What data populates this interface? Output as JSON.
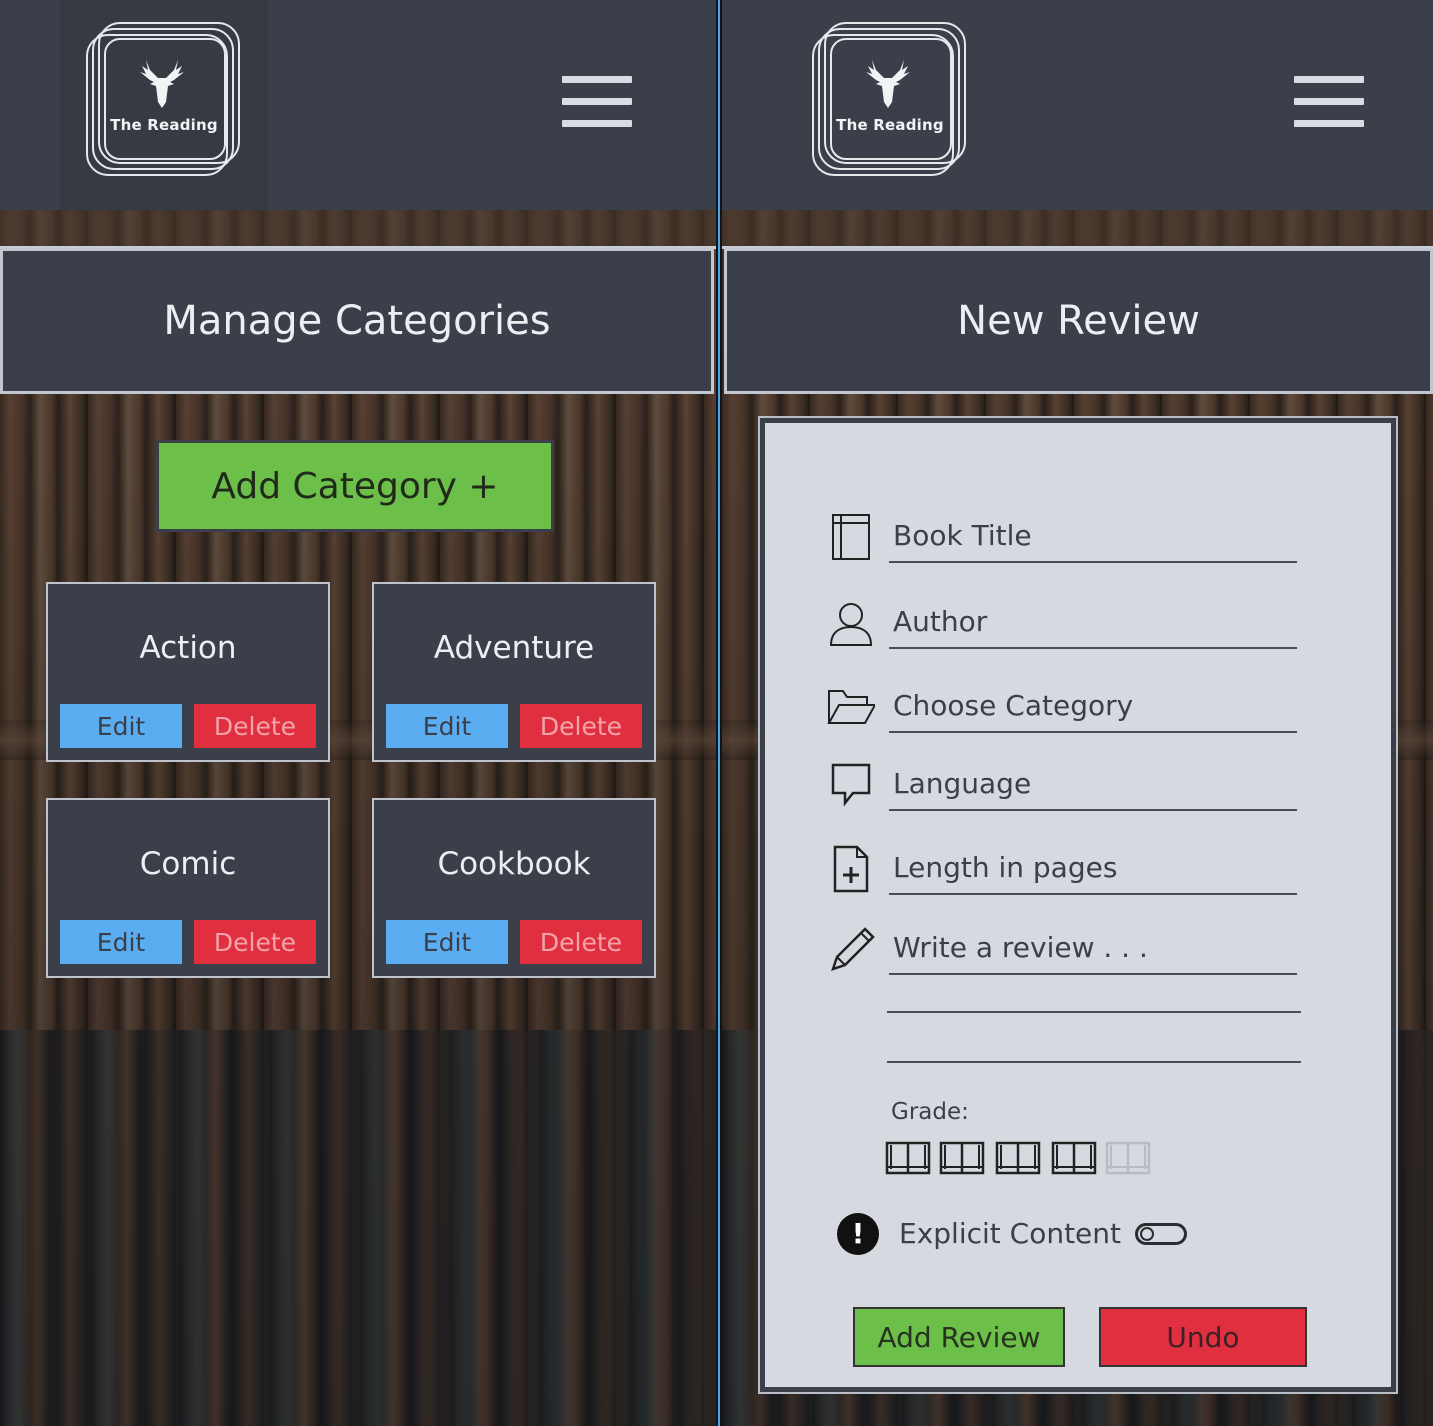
{
  "brand": {
    "name": "The Reading",
    "logo_icon": "deer-head-icon"
  },
  "colors": {
    "header_bg": "#3b3f49",
    "add_green": "#6cc04a",
    "edit_blue": "#5aadf1",
    "delete_red": "#e03040",
    "form_bg": "#d6d9df"
  },
  "left_screen": {
    "title": "Manage Categories",
    "add_button": "Add Category +",
    "categories": [
      {
        "name": "Action",
        "edit": "Edit",
        "delete": "Delete"
      },
      {
        "name": "Adventure",
        "edit": "Edit",
        "delete": "Delete"
      },
      {
        "name": "Comic",
        "edit": "Edit",
        "delete": "Delete"
      },
      {
        "name": "Cookbook",
        "edit": "Edit",
        "delete": "Delete"
      }
    ]
  },
  "right_screen": {
    "title": "New Review",
    "fields": {
      "book_title": "Book Title",
      "author": "Author",
      "category": "Choose Category",
      "language": "Language",
      "length": "Length in pages",
      "review": "Write a review . . ."
    },
    "grade_label": "Grade:",
    "grade_value": 4,
    "grade_max": 5,
    "explicit_label": "Explicit Content",
    "explicit_on": false,
    "add_review": "Add Review",
    "undo": "Undo"
  }
}
